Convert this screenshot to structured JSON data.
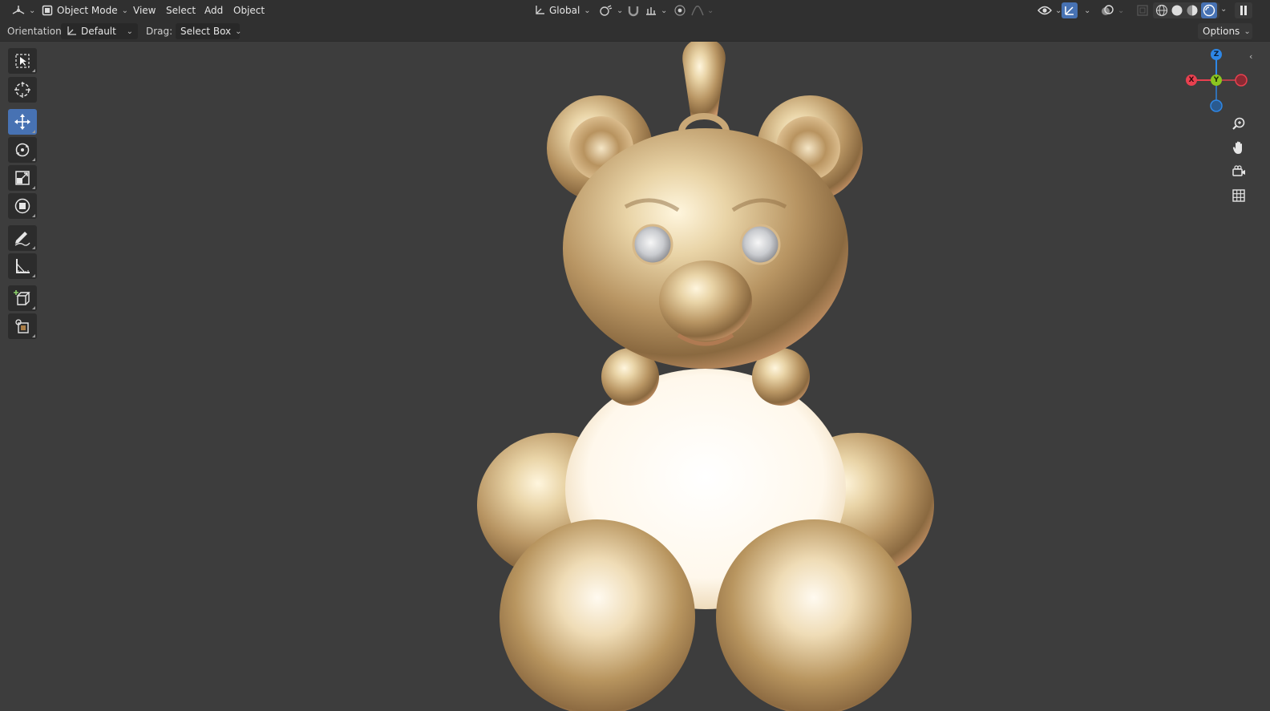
{
  "header": {
    "editor_type_icon": "3d-viewport-icon",
    "mode": {
      "icon": "object-mode-icon",
      "label": "Object Mode"
    },
    "menus": [
      "View",
      "Select",
      "Add",
      "Object"
    ],
    "transform_orientation": {
      "icon": "global-orientation-icon",
      "label": "Global"
    },
    "pivot_icon": "pivot-point-icon",
    "snap_icon": "magnet-icon",
    "snap_target_icon": "snap-increment-icon",
    "proportional_icon": "proportional-edit-icon",
    "falloff_icon": "falloff-curve-icon",
    "right_icons": [
      "visibility-icon",
      "gizmo-icon",
      "overlay-icon",
      "xray-icon",
      "wireframe-shading-icon",
      "solid-shading-icon",
      "material-shading-icon",
      "rendered-shading-icon",
      "pause-icon"
    ]
  },
  "tool_settings": {
    "orientation_label": "Orientation:",
    "orientation_value": "Default",
    "drag_label": "Drag:",
    "drag_value": "Select Box",
    "options_label": "Options"
  },
  "toolbar": {
    "tools": [
      "select-box-tool",
      "cursor-tool",
      "move-tool",
      "rotate-tool",
      "scale-tool",
      "transform-tool",
      "annotate-tool",
      "measure-tool",
      "add-cube-tool",
      "transform-origin-tool"
    ],
    "active": "move-tool"
  },
  "gizmo": {
    "x_label": "X",
    "y_label": "Y",
    "z_label": "Z",
    "colors": {
      "x": "#e8404f",
      "y": "#8bc61f",
      "z": "#2e87e6"
    }
  },
  "nav_buttons": [
    "zoom-icon",
    "pan-hand-icon",
    "camera-view-icon",
    "grid-view-icon"
  ],
  "scene": {
    "object": "gold teddy bear pendant with gem eyes"
  }
}
